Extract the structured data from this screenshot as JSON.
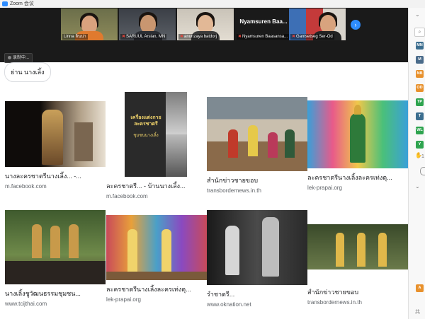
{
  "window": {
    "title": "Zoom 会议"
  },
  "zoom": {
    "participants": [
      {
        "name": "Linna ลินน่า"
      },
      {
        "name": "SARUUL Arslan, MN"
      },
      {
        "name": "anunzaya batdorj"
      },
      {
        "name": "Nyamsuren Baasansa...",
        "display": "Nyamsuren Baa..."
      },
      {
        "name": "Gantsetseg Ser-Od"
      }
    ],
    "share_label": "录制中...",
    "next_arrow": "›"
  },
  "search": {
    "chip": "ย่าน นางเลิ้ง"
  },
  "results": [
    {
      "title": "นางละครชาตรีนางเลิ้ง... -...",
      "source": "m.facebook.com"
    },
    {
      "title": "ละครชาตรี... - บ้านนางเลิ้ง...",
      "source": "m.facebook.com",
      "poster": {
        "title": "เครื่องแต่งกาย ละครชาตรี",
        "sub": "ชุมชนนางเลิ้ง"
      }
    },
    {
      "title": "สำนักข่าวชายขอบ",
      "source": "transbordernews.in.th"
    },
    {
      "title": "ละครชาตรีนางเลิ้งละครเท่งตุ...",
      "source": "lek-prapai.org"
    },
    {
      "title": "นางเลิ้งชูวัฒนธรรมชุมชน...",
      "source": "www.tcijthai.com"
    },
    {
      "title": "ละครชาตรีนางเลิ้งละครเท่งตุ...",
      "source": "lek-prapai.org"
    },
    {
      "title": "รำชาตรี...",
      "source": "www.oknation.net"
    },
    {
      "title": "สำนักข่าวชายขอบ",
      "source": "transbordernews.in.th"
    }
  ],
  "right_panel": {
    "badges": [
      {
        "text": "MN",
        "color": "#3c6e8f"
      },
      {
        "text": "M",
        "color": "#4a6b8a"
      },
      {
        "text": "NB",
        "color": "#e8912d"
      },
      {
        "text": "OD",
        "color": "#e8912d"
      },
      {
        "text": "TP",
        "color": "#2ea44f"
      },
      {
        "text": "T",
        "color": "#3c6e8f"
      },
      {
        "text": "WL",
        "color": "#2ea44f"
      },
      {
        "text": "Y",
        "color": "#2ea44f"
      },
      {
        "text": "A",
        "color": "#e8912d"
      }
    ],
    "count": "1",
    "bottom_text": "共"
  }
}
